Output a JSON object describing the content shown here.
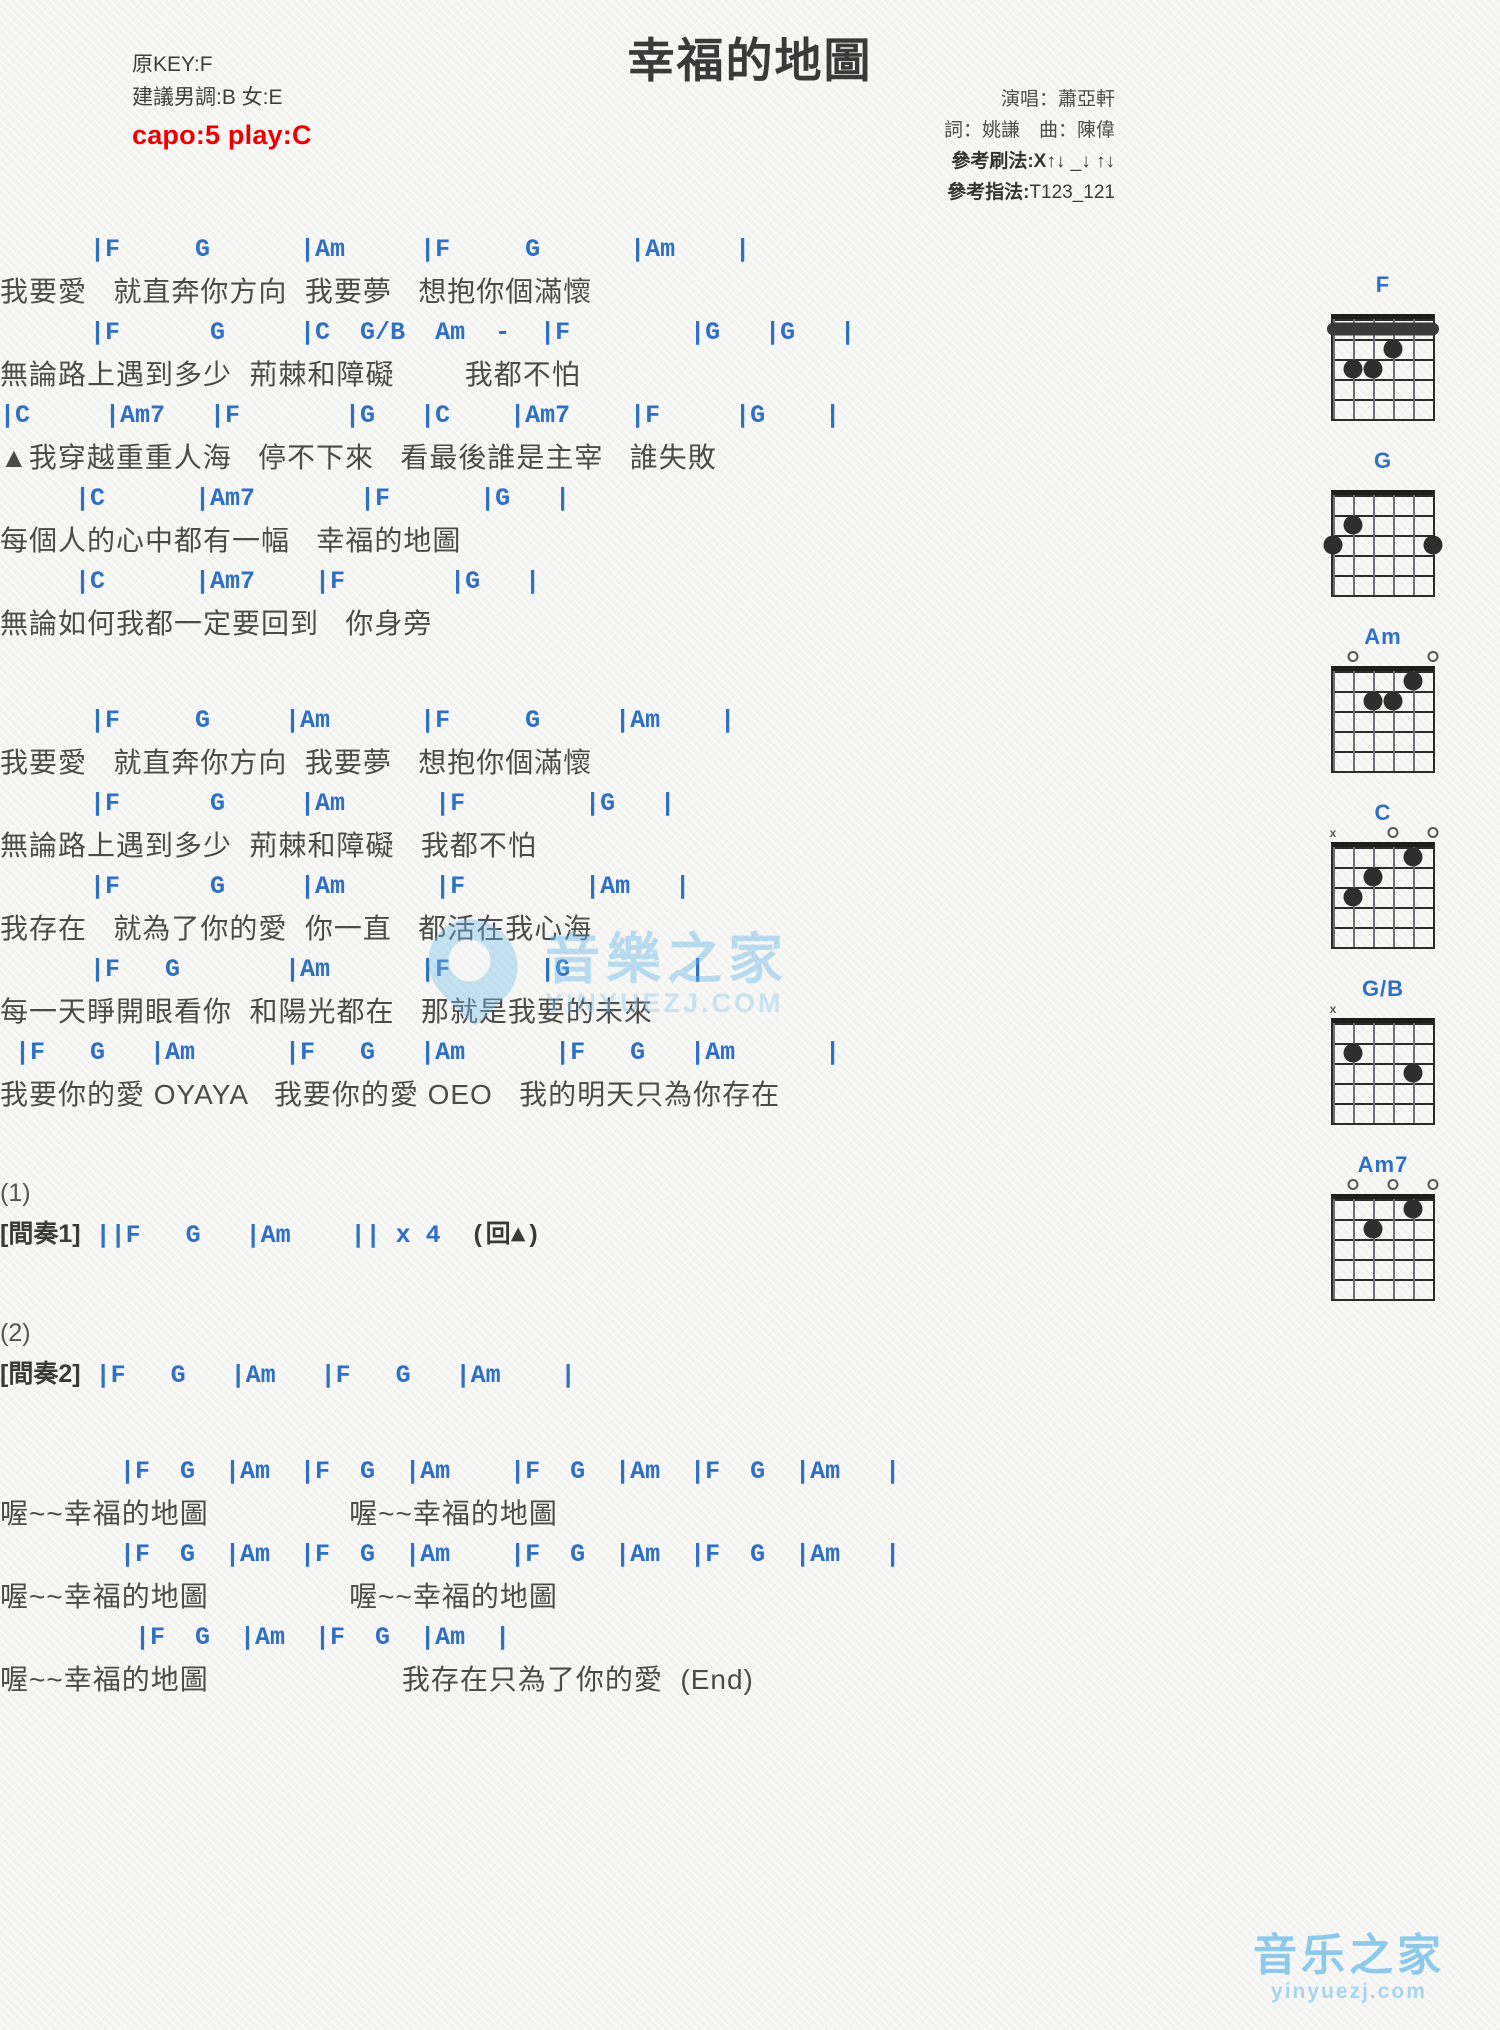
{
  "header": {
    "title": "幸福的地圖",
    "orig_key": "原KEY:F",
    "suggested_key": "建議男調:B 女:E",
    "capo": "capo:5 play:C",
    "singer": "演唱：蕭亞軒",
    "credits": "詞：姚謙　曲：陳偉",
    "strum_label": "參考刷法:X",
    "strum_pattern": "↑↓ _↓ ↑↓",
    "pick_label": "參考指法:",
    "pick_pattern": "T123_121"
  },
  "accent_color": "#2f6fc4",
  "capo_color": "#ee0000",
  "sections": [
    {
      "name": "verse-1",
      "lines": [
        {
          "chords": "      |F     G      |Am     |F     G      |Am    |",
          "lyrics": "我要愛   就直奔你方向  我要夢   想抱你個滿懷"
        },
        {
          "chords": "      |F      G     |C  G/B  Am  -  |F        |G   |G   |",
          "lyrics": "無論路上遇到多少  荊棘和障礙        我都不怕"
        }
      ]
    },
    {
      "name": "chorus-1",
      "lines": [
        {
          "chords": "|C     |Am7   |F       |G   |C    |Am7    |F     |G    |",
          "lyrics": "▲我穿越重重人海   停不下來   看最後誰是主宰   誰失敗"
        },
        {
          "chords": "     |C      |Am7       |F      |G   |",
          "lyrics": "每個人的心中都有一幅   幸福的地圖"
        },
        {
          "chords": "     |C      |Am7    |F       |G   |",
          "lyrics": "無論如何我都一定要回到   你身旁"
        }
      ]
    },
    {
      "name": "verse-2",
      "lines": [
        {
          "chords": "      |F     G     |Am      |F     G     |Am    |",
          "lyrics": "我要愛   就直奔你方向  我要夢   想抱你個滿懷"
        },
        {
          "chords": "      |F      G     |Am      |F        |G   |",
          "lyrics": "無論路上遇到多少  荊棘和障礙   我都不怕"
        },
        {
          "chords": "      |F      G     |Am      |F        |Am   |",
          "lyrics": "我存在   就為了你的愛  你一直   都活在我心海"
        },
        {
          "chords": "      |F   G       |Am      |F      |G        |",
          "lyrics": "每一天睜開眼看你  和陽光都在   那就是我要的未來"
        },
        {
          "chords": " |F   G   |Am      |F   G   |Am      |F   G   |Am      |",
          "lyrics": "我要你的愛 OYAYA   我要你的愛 OEO   我的明天只為你存在"
        }
      ]
    },
    {
      "name": "interlude-1",
      "number": "(1)",
      "label": "[間奏1]",
      "chords": "||F   G   |Am    || x 4",
      "note": "(回▲)"
    },
    {
      "name": "interlude-2",
      "number": "(2)",
      "label": "[間奏2]",
      "chords": "|F   G   |Am   |F   G   |Am    |",
      "note": ""
    },
    {
      "name": "outro",
      "lines": [
        {
          "chords": "        |F  G  |Am  |F  G  |Am    |F  G  |Am  |F  G  |Am   |",
          "lyrics": "喔~~幸福的地圖                喔~~幸福的地圖"
        },
        {
          "chords": "        |F  G  |Am  |F  G  |Am    |F  G  |Am  |F  G  |Am   |",
          "lyrics": "喔~~幸福的地圖                喔~~幸福的地圖"
        },
        {
          "chords": "         |F  G  |Am  |F  G  |Am  |",
          "lyrics": "喔~~幸福的地圖                      我存在只為了你的愛  (End)"
        }
      ]
    }
  ],
  "chord_diagrams": [
    {
      "name": "F",
      "marks": [],
      "barre": {
        "fret": 1,
        "from_string": 6,
        "to_string": 1
      },
      "dots": [
        {
          "string": 3,
          "fret": 2
        },
        {
          "string": 5,
          "fret": 3
        },
        {
          "string": 4,
          "fret": 3
        }
      ]
    },
    {
      "name": "G",
      "marks": [],
      "barre": null,
      "dots": [
        {
          "string": 5,
          "fret": 2
        },
        {
          "string": 6,
          "fret": 3
        },
        {
          "string": 1,
          "fret": 3
        }
      ]
    },
    {
      "name": "Am",
      "marks": [
        {
          "string": 5,
          "type": "open"
        },
        {
          "string": 1,
          "type": "open"
        }
      ],
      "barre": null,
      "dots": [
        {
          "string": 2,
          "fret": 1
        },
        {
          "string": 4,
          "fret": 2
        },
        {
          "string": 3,
          "fret": 2
        }
      ]
    },
    {
      "name": "C",
      "marks": [
        {
          "string": 6,
          "type": "mute"
        },
        {
          "string": 3,
          "type": "open"
        },
        {
          "string": 1,
          "type": "open"
        }
      ],
      "barre": null,
      "dots": [
        {
          "string": 2,
          "fret": 1
        },
        {
          "string": 4,
          "fret": 2
        },
        {
          "string": 5,
          "fret": 3
        }
      ]
    },
    {
      "name": "G/B",
      "marks": [
        {
          "string": 6,
          "type": "mute"
        }
      ],
      "barre": null,
      "dots": [
        {
          "string": 5,
          "fret": 2
        },
        {
          "string": 2,
          "fret": 3
        }
      ]
    },
    {
      "name": "Am7",
      "marks": [
        {
          "string": 5,
          "type": "open"
        },
        {
          "string": 3,
          "type": "open"
        },
        {
          "string": 1,
          "type": "open"
        }
      ],
      "barre": null,
      "dots": [
        {
          "string": 2,
          "fret": 1
        },
        {
          "string": 4,
          "fret": 2
        }
      ]
    }
  ],
  "watermark": {
    "main": "音樂之家",
    "sub": "YINYUEZJ.COM",
    "bottom_main": "音乐之家",
    "bottom_sub": "yinyuezj.com"
  }
}
